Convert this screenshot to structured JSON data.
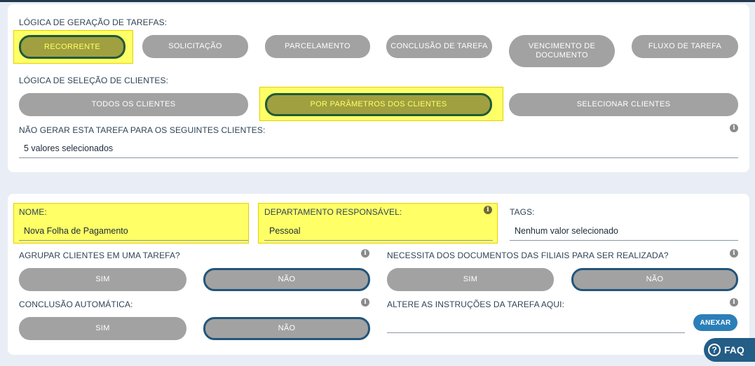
{
  "generation": {
    "label": "LÓGICA DE GERAÇÃO DE TAREFAS:",
    "options": [
      "RECORRENTE",
      "SOLICITAÇÃO",
      "PARCELAMENTO",
      "CONCLUSÃO DE TAREFA",
      "VENCIMENTO DE DOCUMENTO",
      "FLUXO DE TAREFA"
    ],
    "selected": "RECORRENTE"
  },
  "client_selection": {
    "label": "LÓGICA DE SELEÇÃO DE CLIENTES:",
    "options": [
      "TODOS OS CLIENTES",
      "POR PARÂMETROS DOS CLIENTES",
      "SELECIONAR CLIENTES"
    ],
    "selected": "POR PARÂMETROS DOS CLIENTES"
  },
  "exclude_clients": {
    "label": "NÃO GERAR ESTA TAREFA PARA OS SEGUINTES CLIENTES:",
    "value": "5 valores selecionados"
  },
  "name": {
    "label": "NOME:",
    "value": "Nova Folha de Pagamento"
  },
  "department": {
    "label": "DEPARTAMENTO RESPONSÁVEL:",
    "value": "Pessoal"
  },
  "tags": {
    "label": "TAGS:",
    "value": "Nenhum valor selecionado"
  },
  "group_clients": {
    "label": "AGRUPAR CLIENTES EM UMA TAREFA?",
    "yes": "SIM",
    "no": "NÃO",
    "selected": "NÃO"
  },
  "branch_docs": {
    "label": "NECESSITA DOS DOCUMENTOS DAS FILIAIS PARA SER REALIZADA?",
    "yes": "SIM",
    "no": "NÃO",
    "selected": "NÃO"
  },
  "auto_conclusion": {
    "label": "CONCLUSÃO AUTOMÁTICA:",
    "yes": "SIM",
    "no": "NÃO",
    "selected": "NÃO"
  },
  "instructions": {
    "label": "ALTERE AS INSTRUÇÕES DA TAREFA AQUI:",
    "value": ""
  },
  "attach_label": "ANEXAR",
  "faq_label": "FAQ",
  "colors": {
    "highlight": "#ffff66",
    "selected_pill": "#a0a040",
    "pill": "#a2a2a2",
    "outline_blue": "#23557a",
    "attach_button": "#2b7fb8",
    "faq_button": "#245d86"
  },
  "icons": [
    "info-icon",
    "question-icon"
  ]
}
